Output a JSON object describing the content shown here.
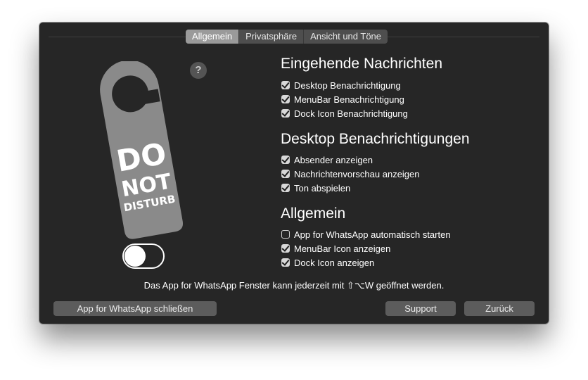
{
  "tabs": [
    {
      "label": "Allgemein",
      "active": true
    },
    {
      "label": "Privatsphäre",
      "active": false
    },
    {
      "label": "Ansicht und Töne",
      "active": false
    }
  ],
  "hanger": {
    "line1": "DO",
    "line2": "NOT",
    "line3": "DISTURB"
  },
  "help_label": "?",
  "dnd_toggle": {
    "on": false
  },
  "sections": {
    "incoming": {
      "title": "Eingehende Nachrichten",
      "options": [
        {
          "label": "Desktop Benachrichtigung",
          "checked": true
        },
        {
          "label": "MenuBar Benachrichtigung",
          "checked": true
        },
        {
          "label": "Dock Icon Benachrichtigung",
          "checked": true
        }
      ]
    },
    "desktop": {
      "title": "Desktop Benachrichtigungen",
      "options": [
        {
          "label": "Absender anzeigen",
          "checked": true
        },
        {
          "label": "Nachrichtenvorschau anzeigen",
          "checked": true
        },
        {
          "label": "Ton abspielen",
          "checked": true
        }
      ]
    },
    "general": {
      "title": "Allgemein",
      "options": [
        {
          "label": "App for WhatsApp automatisch starten",
          "checked": false
        },
        {
          "label": "MenuBar Icon anzeigen",
          "checked": true
        },
        {
          "label": "Dock Icon anzeigen",
          "checked": true
        }
      ]
    }
  },
  "footer_note": "Das App for WhatsApp Fenster kann jederzeit mit ⇧⌥W geöffnet werden.",
  "buttons": {
    "quit": "App for WhatsApp schließen",
    "support": "Support",
    "back": "Zurück"
  }
}
